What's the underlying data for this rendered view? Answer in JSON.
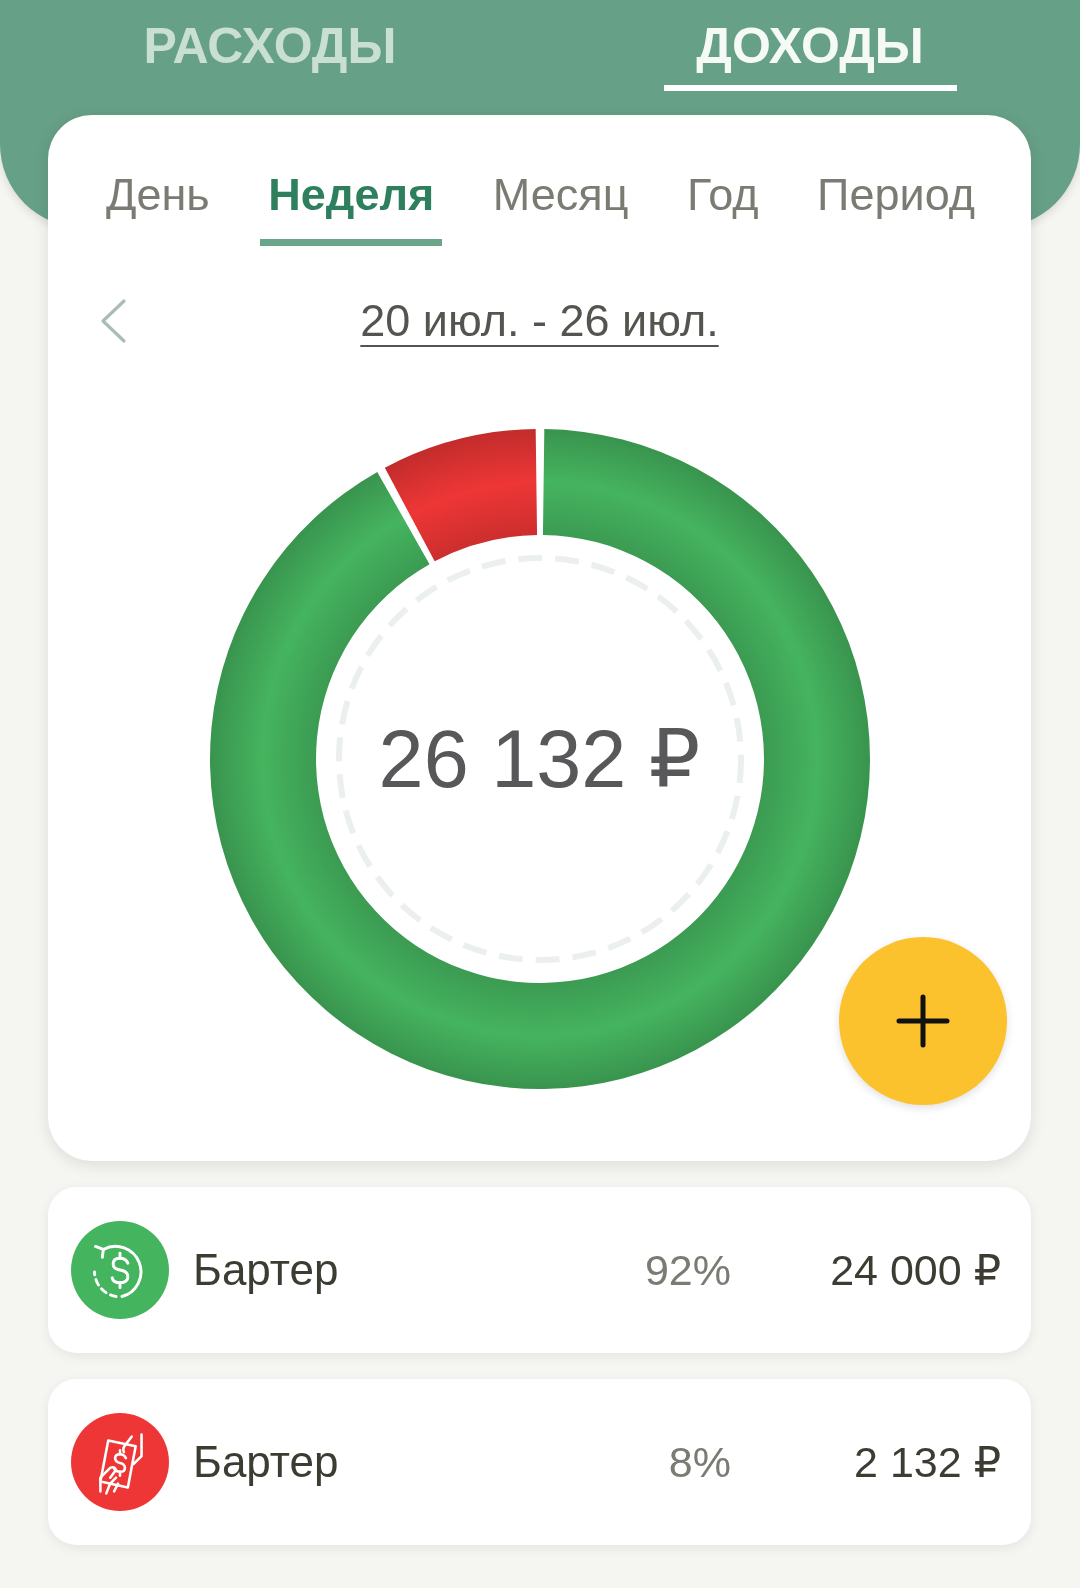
{
  "top_tabs": [
    {
      "label": "РАСХОДЫ",
      "selected": false
    },
    {
      "label": "ДОХОДЫ",
      "selected": true
    }
  ],
  "period_tabs": [
    {
      "label": "День",
      "selected": false
    },
    {
      "label": "Неделя",
      "selected": true
    },
    {
      "label": "Месяц",
      "selected": false
    },
    {
      "label": "Год",
      "selected": false
    },
    {
      "label": "Период",
      "selected": false
    }
  ],
  "date_range": "20 июл. - 26 июл.",
  "summary": {
    "total": "26 132 ₽",
    "chart_data": {
      "type": "donut",
      "values": [
        92,
        8
      ]
    }
  },
  "categories": [
    {
      "kind": "cashback",
      "name": "Бартер",
      "percent": "92%",
      "amount": "24 000 ₽",
      "color": "#45b45f"
    },
    {
      "kind": "exchange",
      "name": "Бартер",
      "percent": "8%",
      "amount": "2 132 ₽",
      "color": "#ee3636"
    }
  ]
}
